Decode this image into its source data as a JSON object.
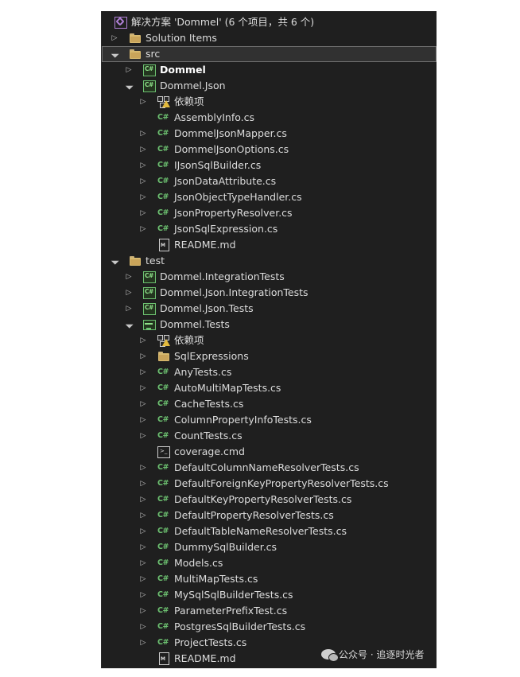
{
  "explorer": {
    "rows": [
      {
        "label": "解决方案 'Dommel' (6 个项目，共 6 个)",
        "icon": "solution-icon",
        "expander": "none"
      },
      {
        "label": "Solution Items",
        "icon": "folder-icon",
        "expander": "collapsed"
      },
      {
        "label": "src",
        "icon": "folder-icon",
        "expander": "expanded",
        "selected": true
      },
      {
        "label": "Dommel",
        "icon": "csharp-project-icon",
        "expander": "collapsed",
        "bold": true
      },
      {
        "label": "Dommel.Json",
        "icon": "csharp-project-icon",
        "expander": "expanded"
      },
      {
        "label": "依赖项",
        "icon": "dependencies-warning-icon",
        "expander": "collapsed"
      },
      {
        "label": "AssemblyInfo.cs",
        "icon": "csharp-file-icon",
        "expander": "none"
      },
      {
        "label": "DommelJsonMapper.cs",
        "icon": "csharp-file-icon",
        "expander": "collapsed"
      },
      {
        "label": "DommelJsonOptions.cs",
        "icon": "csharp-file-icon",
        "expander": "collapsed"
      },
      {
        "label": "IJsonSqlBuilder.cs",
        "icon": "csharp-file-icon",
        "expander": "collapsed"
      },
      {
        "label": "JsonDataAttribute.cs",
        "icon": "csharp-file-icon",
        "expander": "collapsed"
      },
      {
        "label": "JsonObjectTypeHandler.cs",
        "icon": "csharp-file-icon",
        "expander": "collapsed"
      },
      {
        "label": "JsonPropertyResolver.cs",
        "icon": "csharp-file-icon",
        "expander": "collapsed"
      },
      {
        "label": "JsonSqlExpression.cs",
        "icon": "csharp-file-icon",
        "expander": "collapsed"
      },
      {
        "label": "README.md",
        "icon": "markdown-file-icon",
        "expander": "none"
      },
      {
        "label": "test",
        "icon": "folder-icon",
        "expander": "expanded"
      },
      {
        "label": "Dommel.IntegrationTests",
        "icon": "csharp-project-icon",
        "expander": "collapsed"
      },
      {
        "label": "Dommel.Json.IntegrationTests",
        "icon": "csharp-project-icon",
        "expander": "collapsed"
      },
      {
        "label": "Dommel.Json.Tests",
        "icon": "csharp-project-icon",
        "expander": "collapsed"
      },
      {
        "label": "Dommel.Tests",
        "icon": "test-project-icon",
        "expander": "expanded"
      },
      {
        "label": "依赖项",
        "icon": "dependencies-warning-icon",
        "expander": "collapsed"
      },
      {
        "label": "SqlExpressions",
        "icon": "folder-icon",
        "expander": "collapsed"
      },
      {
        "label": "AnyTests.cs",
        "icon": "csharp-file-icon",
        "expander": "collapsed"
      },
      {
        "label": "AutoMultiMapTests.cs",
        "icon": "csharp-file-icon",
        "expander": "collapsed"
      },
      {
        "label": "CacheTests.cs",
        "icon": "csharp-file-icon",
        "expander": "collapsed"
      },
      {
        "label": "ColumnPropertyInfoTests.cs",
        "icon": "csharp-file-icon",
        "expander": "collapsed"
      },
      {
        "label": "CountTests.cs",
        "icon": "csharp-file-icon",
        "expander": "collapsed"
      },
      {
        "label": "coverage.cmd",
        "icon": "cmd-file-icon",
        "expander": "none"
      },
      {
        "label": "DefaultColumnNameResolverTests.cs",
        "icon": "csharp-file-icon",
        "expander": "collapsed"
      },
      {
        "label": "DefaultForeignKeyPropertyResolverTests.cs",
        "icon": "csharp-file-icon",
        "expander": "collapsed"
      },
      {
        "label": "DefaultKeyPropertyResolverTests.cs",
        "icon": "csharp-file-icon",
        "expander": "collapsed"
      },
      {
        "label": "DefaultPropertyResolverTests.cs",
        "icon": "csharp-file-icon",
        "expander": "collapsed"
      },
      {
        "label": "DefaultTableNameResolverTests.cs",
        "icon": "csharp-file-icon",
        "expander": "collapsed"
      },
      {
        "label": "DummySqlBuilder.cs",
        "icon": "csharp-file-icon",
        "expander": "collapsed"
      },
      {
        "label": "Models.cs",
        "icon": "csharp-file-icon",
        "expander": "collapsed"
      },
      {
        "label": "MultiMapTests.cs",
        "icon": "csharp-file-icon",
        "expander": "collapsed"
      },
      {
        "label": "MySqlSqlBuilderTests.cs",
        "icon": "csharp-file-icon",
        "expander": "collapsed"
      },
      {
        "label": "ParameterPrefixTest.cs",
        "icon": "csharp-file-icon",
        "expander": "collapsed"
      },
      {
        "label": "PostgresSqlBuilderTests.cs",
        "icon": "csharp-file-icon",
        "expander": "collapsed"
      },
      {
        "label": "ProjectTests.cs",
        "icon": "csharp-file-icon",
        "expander": "collapsed"
      },
      {
        "label": "README.md",
        "icon": "markdown-file-icon",
        "expander": "none"
      }
    ]
  },
  "watermark": {
    "text": "公众号 · 追逐时光者",
    "icon": "wechat-icon"
  }
}
